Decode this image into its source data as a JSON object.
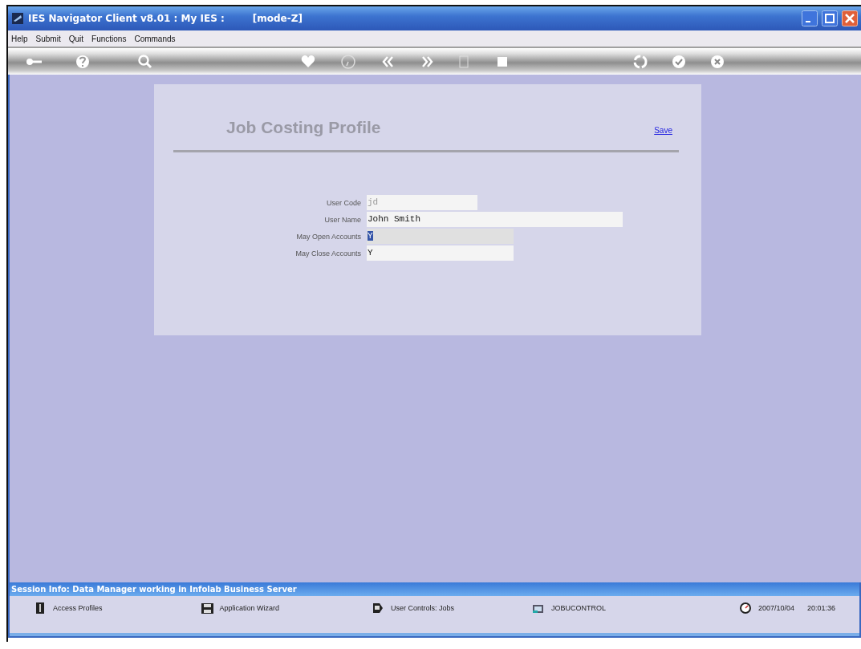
{
  "window": {
    "title": "IES Navigator Client v8.01 : My IES :",
    "mode": "[mode-Z]"
  },
  "menu": [
    "Help",
    "Submit",
    "Quit",
    "Functions",
    "Commands"
  ],
  "form": {
    "title": "Job Costing Profile",
    "save_link": "Save",
    "fields": [
      {
        "label": "User Code",
        "value": "jd",
        "disabled": true,
        "focused": false
      },
      {
        "label": "User Name",
        "value": "John Smith",
        "disabled": false,
        "focused": false
      },
      {
        "label": "May Open Accounts",
        "value": "Y",
        "disabled": false,
        "focused": true
      },
      {
        "label": "May Close Accounts",
        "value": "Y",
        "disabled": false,
        "focused": false
      }
    ]
  },
  "session_info": "Session Info: Data Manager working in Infolab Business Server",
  "status_bar": {
    "items": [
      {
        "kind": "profiles",
        "text": "Access Profiles"
      },
      {
        "kind": "wizard",
        "text": "Application Wizard"
      },
      {
        "kind": "controls",
        "text": "User Controls: Jobs"
      },
      {
        "kind": "table",
        "text": "JOBUCONTROL"
      }
    ],
    "date": "2007/10/04",
    "time": "20:01:36"
  }
}
